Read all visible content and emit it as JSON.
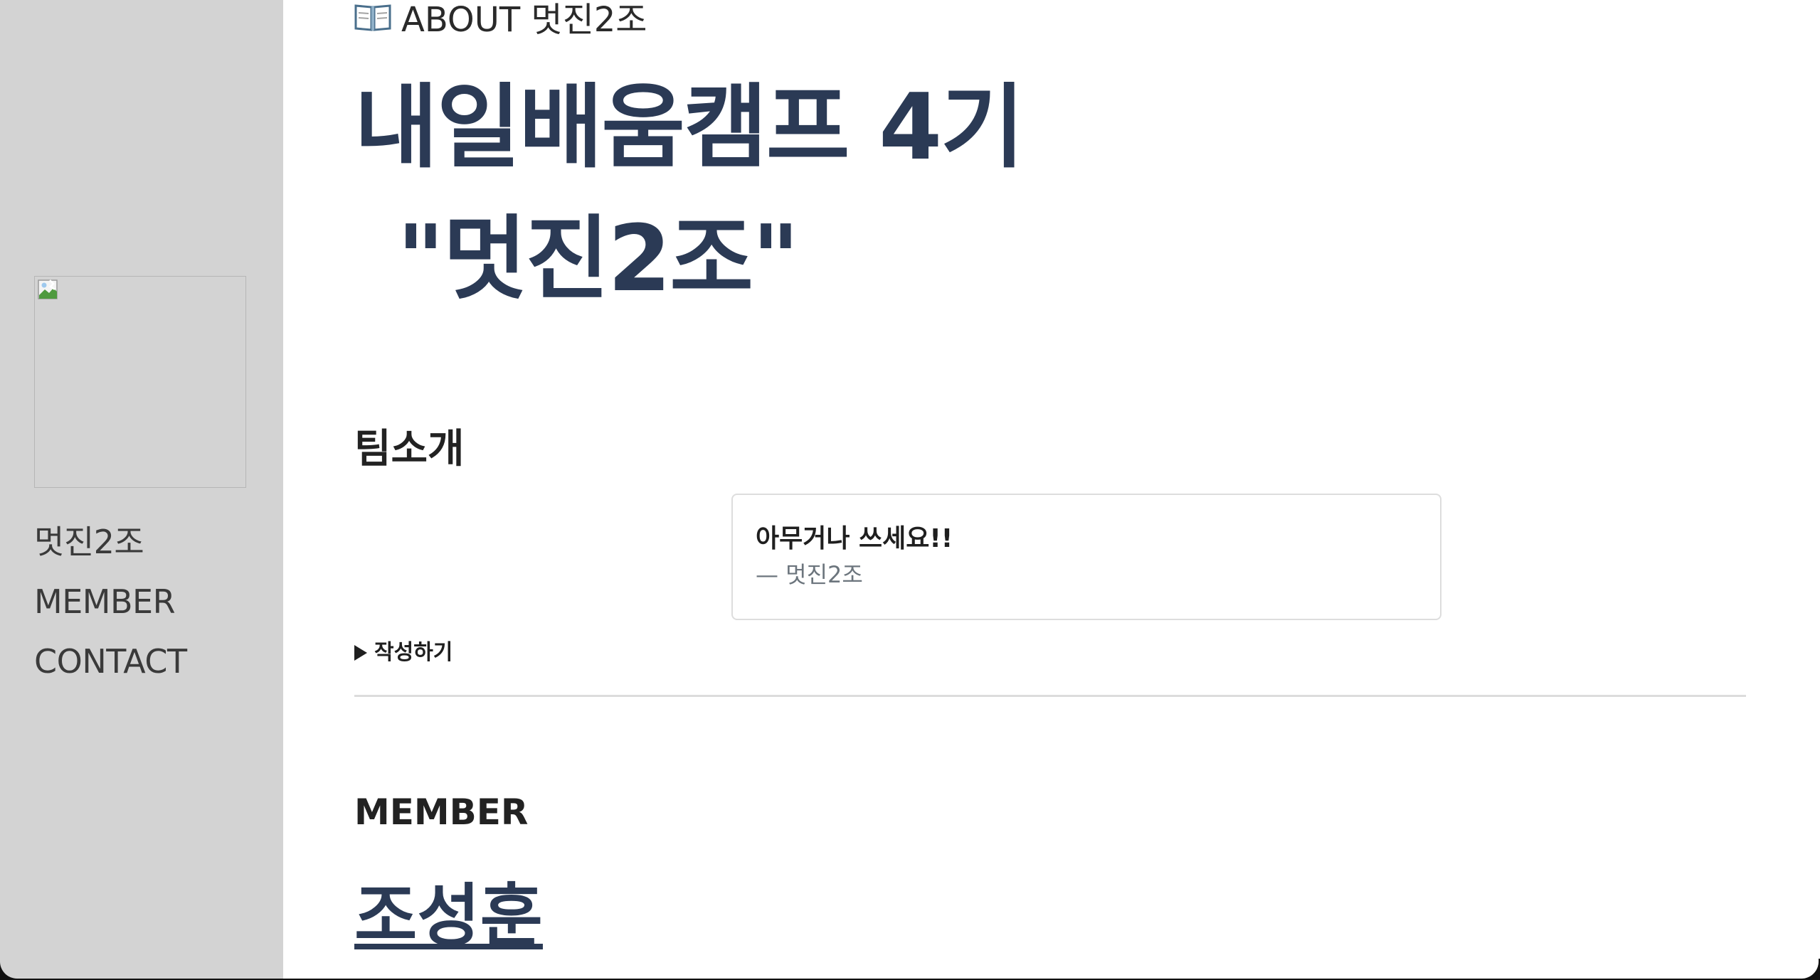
{
  "sidebar": {
    "logo_alt": "",
    "nav": [
      {
        "label": "멋진2조"
      },
      {
        "label": "MEMBER"
      },
      {
        "label": "CONTACT"
      }
    ]
  },
  "main": {
    "page_heading": "ABOUT 멋진2조",
    "page_heading_icon": "open-book-icon",
    "hero_line1": "내일배움캠프 4기",
    "hero_line2": "\"멋진2조\"",
    "team_section_title": "팀소개",
    "quote": {
      "text": "아무거나 쓰세요!!",
      "author": "— 멋진2조"
    },
    "details_label": "작성하기",
    "member_section_title": "MEMBER",
    "member_name": "조성훈"
  },
  "colors": {
    "sidebar_bg": "#d3d3d3",
    "hero_text": "#2b3a55",
    "quote_author": "#6c757d",
    "divider": "#dcdcdc"
  }
}
